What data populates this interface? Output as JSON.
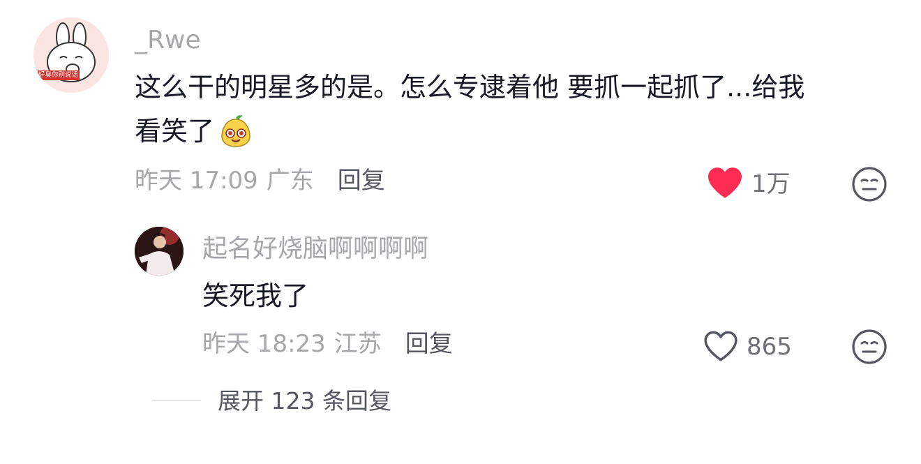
{
  "comment": {
    "username": "_Rwe",
    "avatar_caption": "好臭你别说话",
    "text_line1": "这么干的明星多的是。怎么专逮着他 要抓一起抓了...给我",
    "text_line2": "看笑了",
    "emoji_icon": "laughing-pear-emoji",
    "time": "昨天 17:09",
    "location": "广东",
    "reply_label": "回复",
    "like_count": "1万",
    "liked": true,
    "like_color": "#fe2c55"
  },
  "reply": {
    "username": "起名好烧脑啊啊啊啊",
    "text": "笑死我了",
    "time": "昨天 18:23",
    "location": "江苏",
    "reply_label": "回复",
    "like_count": "865",
    "liked": false
  },
  "expand": {
    "label": "展开 123 条回复"
  }
}
